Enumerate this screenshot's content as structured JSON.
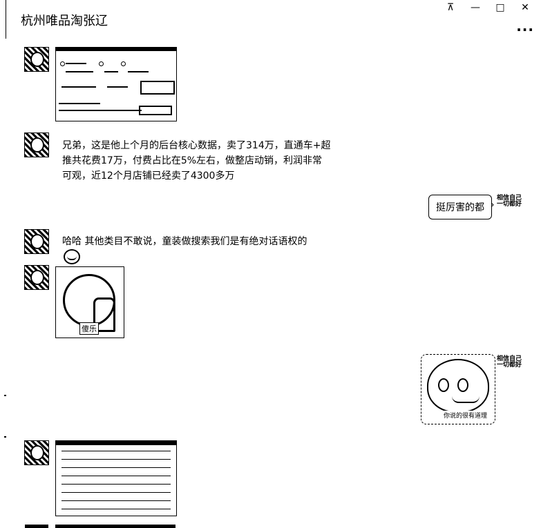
{
  "window": {
    "title": "杭州唯品淘张辽",
    "pin_label": "⊼",
    "minimize_label": "—",
    "maximize_label": "□",
    "close_label": "✕",
    "more_label": "..."
  },
  "messages": {
    "m1_text": "兄弟，这是他上个月的后台核心数据，卖了314万，直通车+超推共花费17万，付费占比在5%左右，做整店动销，利润非常可观，近12个月店铺已经卖了4300多万",
    "m2_text": "挺厉害的都",
    "m3_text": "哈哈 其他类目不敢说，童装做搜索我们是有绝对话语权的",
    "photo_caption": "傻乐",
    "squirtle_caption": "你说的很有道理"
  },
  "stickers": {
    "right_label": "相信自己一切都好"
  },
  "icons": {
    "emoji_grin": "grinning-face-icon"
  }
}
